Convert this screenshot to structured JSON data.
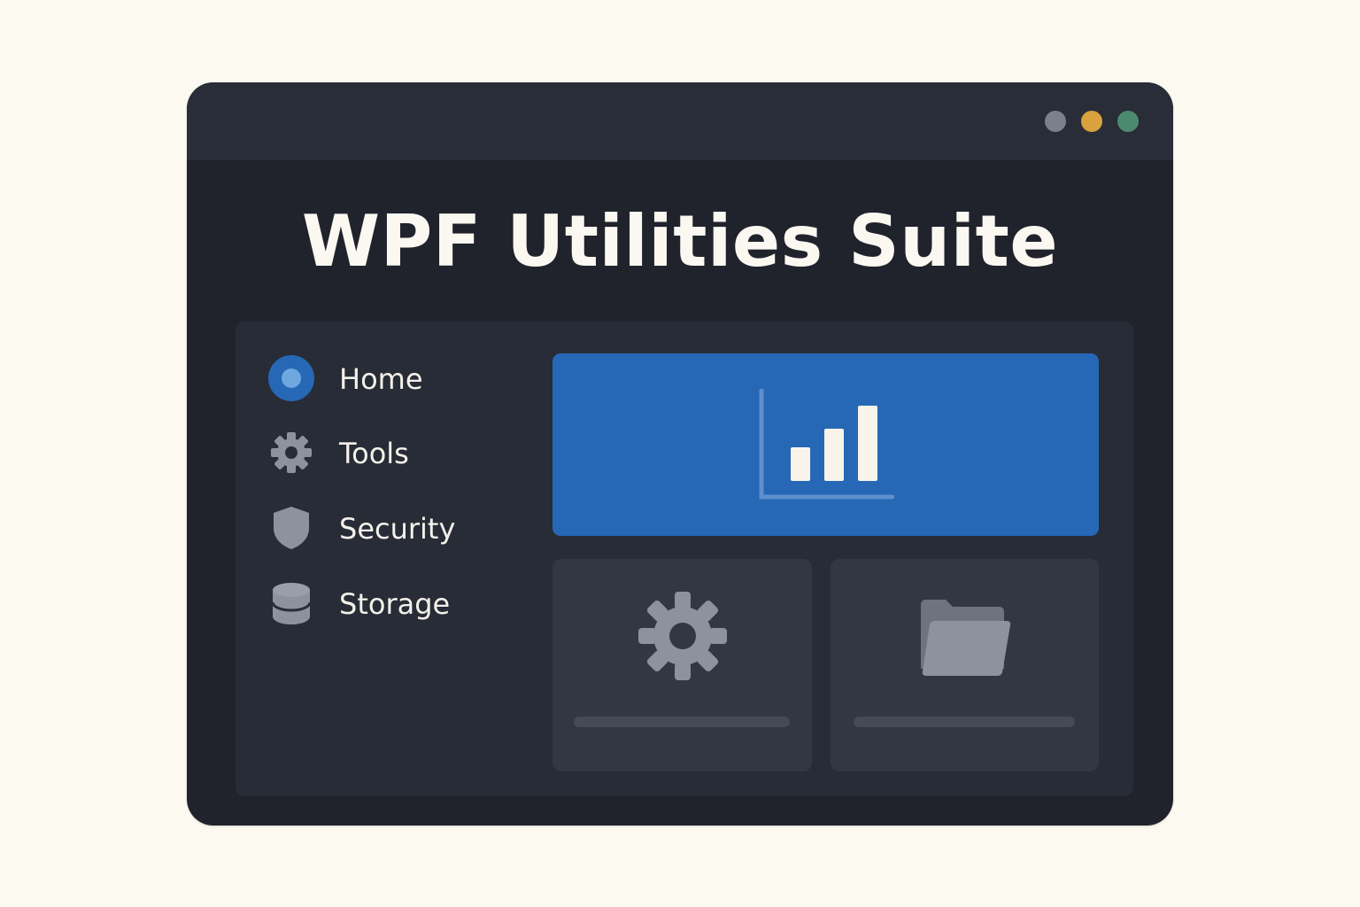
{
  "window": {
    "title": "WPF Utilities Suite",
    "controls": [
      {
        "name": "minimize",
        "color": "#7c808a"
      },
      {
        "name": "maximize",
        "color": "#d9a23d"
      },
      {
        "name": "close",
        "color": "#4c8a6f"
      }
    ]
  },
  "sidebar": {
    "items": [
      {
        "label": "Home",
        "icon": "radio-dot-icon",
        "active": true
      },
      {
        "label": "Tools",
        "icon": "gear-icon"
      },
      {
        "label": "Security",
        "icon": "shield-icon"
      },
      {
        "label": "Storage",
        "icon": "database-icon"
      }
    ]
  },
  "dashboard": {
    "feature_card": {
      "icon": "bar-chart-icon"
    },
    "tiles": [
      {
        "icon": "gear-icon"
      },
      {
        "icon": "folder-icon"
      }
    ]
  },
  "colors": {
    "accent": "#2668b6",
    "background": "#20232c",
    "panel": "#282c36",
    "tile": "#323743",
    "icon_gray": "#8e929c"
  }
}
